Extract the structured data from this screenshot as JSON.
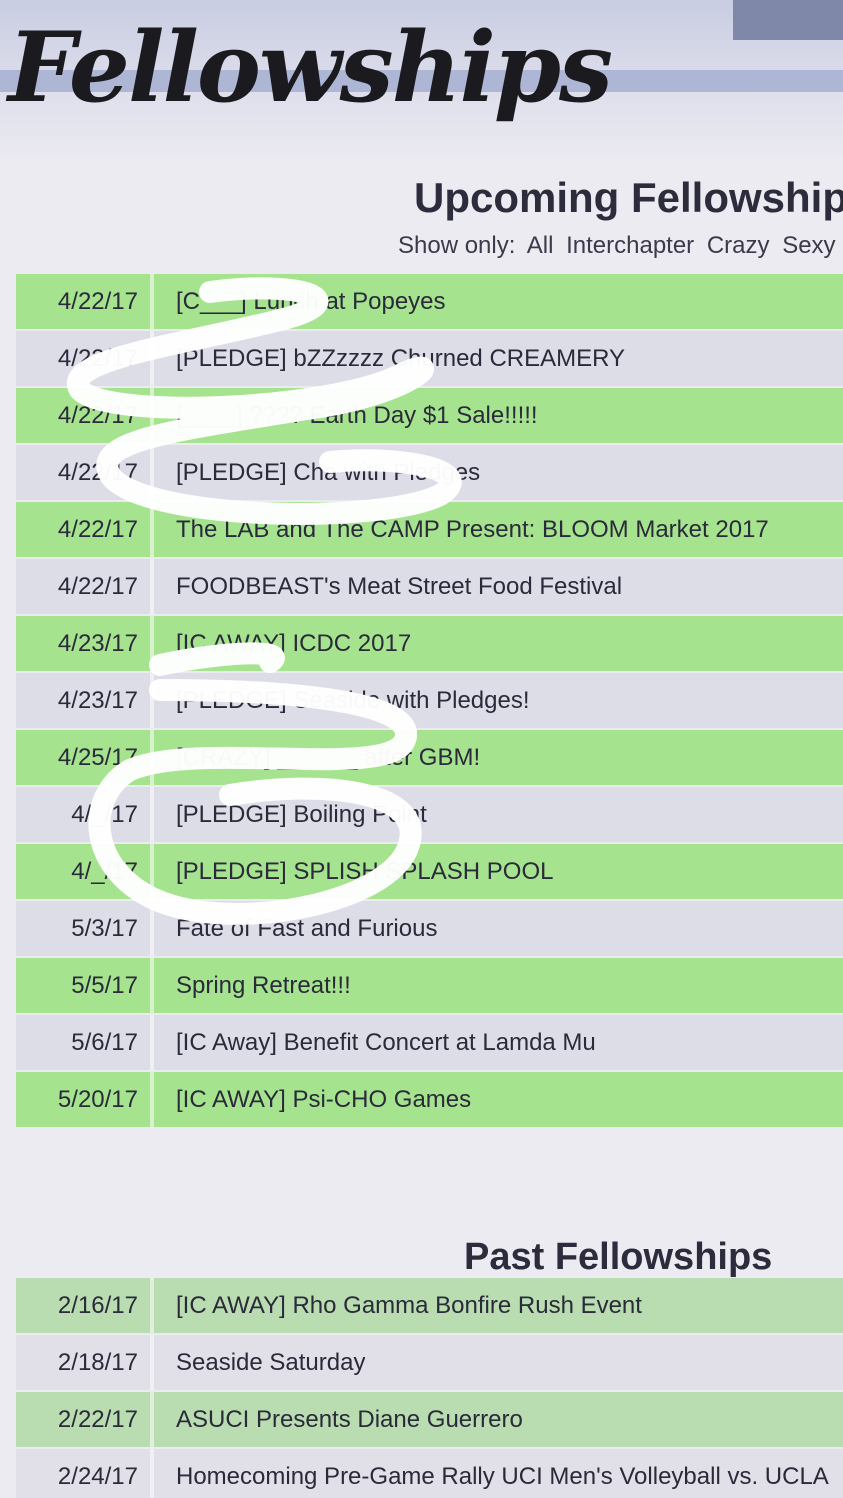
{
  "header": {
    "site_title": "Fellowships",
    "upcoming_title": "Upcoming Fellowship",
    "past_title": "Past Fellowships"
  },
  "filter": {
    "label": "Show only:",
    "options": [
      "All",
      "Interchapter",
      "Crazy",
      "Sexy"
    ]
  },
  "upcoming": [
    {
      "date": "4/22/17",
      "title": "[C___] Lunch at Popeyes"
    },
    {
      "date": "4/22/17",
      "title": "[PLEDGE] bZZzzzz Churned CREAMERY"
    },
    {
      "date": "4/22/17",
      "title": "[____] ???? Earth Day $1 Sale!!!!!"
    },
    {
      "date": "4/22/17",
      "title": "[PLEDGE] Cha with Pledges"
    },
    {
      "date": "4/22/17",
      "title": "The LAB and The CAMP Present: BLOOM Market 2017"
    },
    {
      "date": "4/22/17",
      "title": "FOODBEAST's Meat Street Food Festival"
    },
    {
      "date": "4/23/17",
      "title": "[IC AWAY] ICDC 2017"
    },
    {
      "date": "4/23/17",
      "title": "[PLEDGE] Seaside with Pledges!"
    },
    {
      "date": "4/25/17",
      "title": "[CRAZY] ______ after GBM!"
    },
    {
      "date": "4/_/17",
      "title": "[PLEDGE] Boiling Point"
    },
    {
      "date": "4/_/17",
      "title": "[PLEDGE] SPLISH SPLASH POOL"
    },
    {
      "date": "5/3/17",
      "title": "Fate of Fast and Furious"
    },
    {
      "date": "5/5/17",
      "title": "Spring Retreat!!!"
    },
    {
      "date": "5/6/17",
      "title": "[IC Away] Benefit Concert at Lamda Mu"
    },
    {
      "date": "5/20/17",
      "title": "[IC AWAY] Psi-CHO Games"
    }
  ],
  "past": [
    {
      "date": "2/16/17",
      "title": "[IC AWAY] Rho Gamma Bonfire Rush Event"
    },
    {
      "date": "2/18/17",
      "title": "Seaside Saturday"
    },
    {
      "date": "2/22/17",
      "title": "ASUCI Presents Diane Guerrero"
    },
    {
      "date": "2/24/17",
      "title": "Homecoming Pre-Game Rally UCI Men's Volleyball vs. UCLA"
    }
  ]
}
